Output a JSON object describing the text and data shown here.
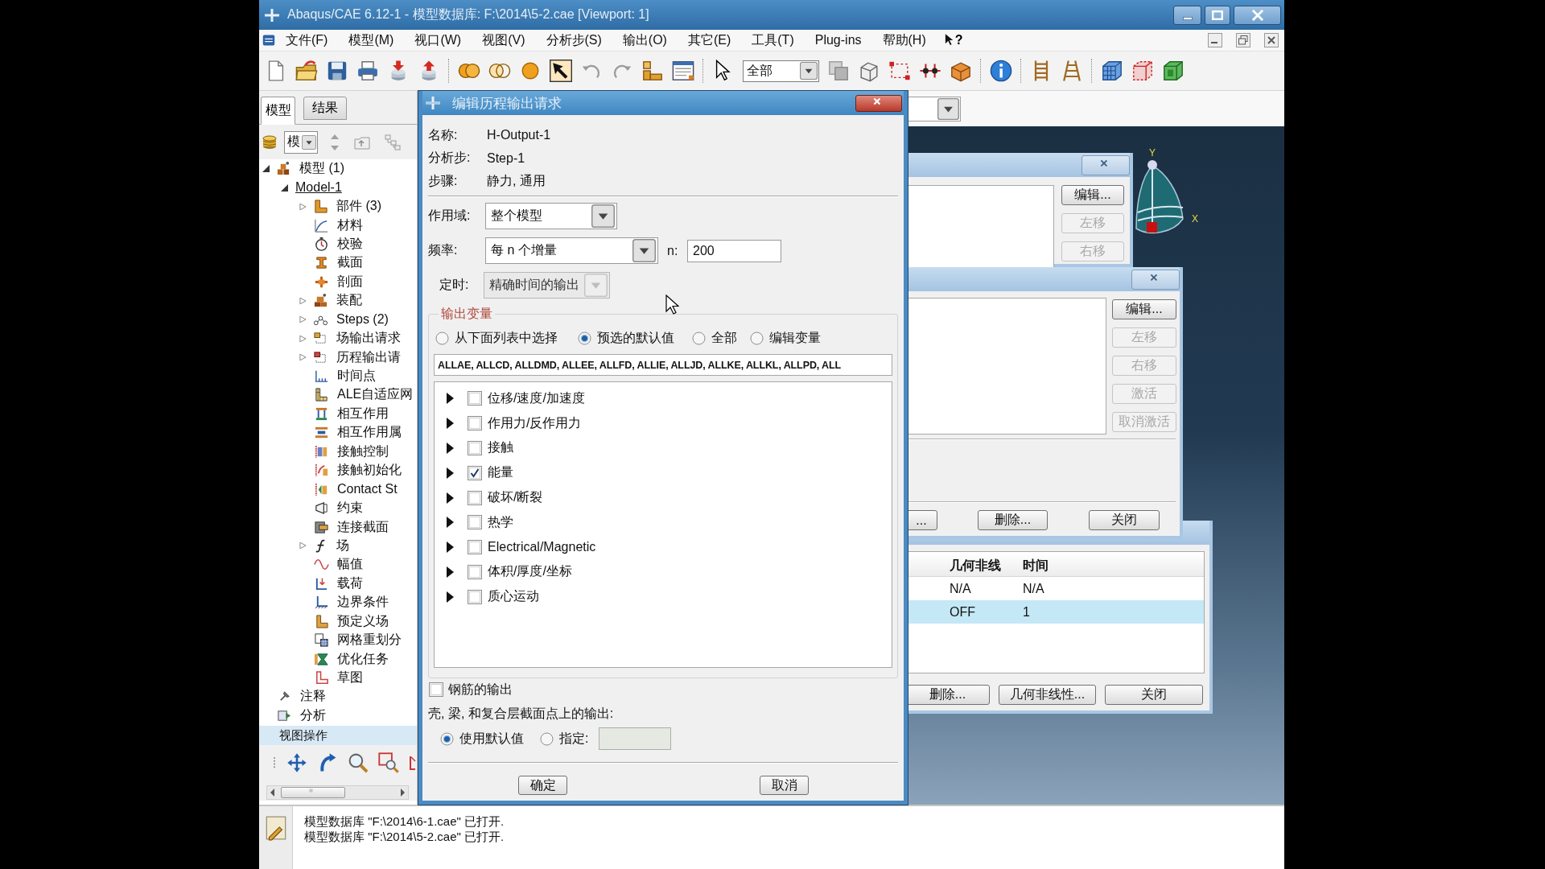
{
  "window": {
    "title": "Abaqus/CAE 6.12-1 - 模型数据库: F:\\2014\\5-2.cae [Viewport: 1]"
  },
  "menu": {
    "items": [
      "文件(F)",
      "模型(M)",
      "视口(W)",
      "视图(V)",
      "分析步(S)",
      "输出(O)",
      "其它(E)",
      "工具(T)",
      "Plug-ins",
      "帮助(H)"
    ],
    "whats_this": "?"
  },
  "toolbar": {
    "selection_filter": "全部"
  },
  "left_panel": {
    "tabs": [
      {
        "label": "模型",
        "selected": true
      },
      {
        "label": "结果",
        "selected": false
      }
    ],
    "tree_filter": "模",
    "tree": [
      {
        "label": "模型 (1)",
        "kind": "models",
        "expanded": true,
        "children": [
          {
            "label": "Model-1",
            "expanded": true,
            "current": true,
            "children": [
              {
                "label": "部件 (3)",
                "kind": "parts",
                "expanded": false
              },
              {
                "label": "材料",
                "kind": "materials"
              },
              {
                "label": "校验",
                "kind": "calibrations"
              },
              {
                "label": "截面",
                "kind": "sections"
              },
              {
                "label": "剖面",
                "kind": "profiles"
              },
              {
                "label": "装配",
                "kind": "assembly",
                "expanded": false
              },
              {
                "label": "Steps (2)",
                "kind": "steps",
                "expanded": false
              },
              {
                "label": "场输出请求",
                "kind": "fieldoutput",
                "expanded": false
              },
              {
                "label": "历程输出请",
                "kind": "historyoutput",
                "expanded": false
              },
              {
                "label": "时间点",
                "kind": "timepoints"
              },
              {
                "label": "ALE自适应网",
                "kind": "ale"
              },
              {
                "label": "相互作用",
                "kind": "interactions"
              },
              {
                "label": "相互作用属",
                "kind": "interactionprops"
              },
              {
                "label": "接触控制",
                "kind": "contactcontrols"
              },
              {
                "label": "接触初始化",
                "kind": "contactinits"
              },
              {
                "label": "Contact St",
                "kind": "contactstabilizations"
              },
              {
                "label": "约束",
                "kind": "constraints"
              },
              {
                "label": "连接截面",
                "kind": "connectorsections"
              },
              {
                "label": "场",
                "kind": "fields",
                "expanded": false
              },
              {
                "label": "幅值",
                "kind": "amplitudes"
              },
              {
                "label": "载荷",
                "kind": "loads"
              },
              {
                "label": "边界条件",
                "kind": "bcs"
              },
              {
                "label": "预定义场",
                "kind": "predefined"
              },
              {
                "label": "网格重划分",
                "kind": "remeshing"
              },
              {
                "label": "优化任务",
                "kind": "optimization"
              },
              {
                "label": "草图",
                "kind": "sketches"
              }
            ]
          }
        ]
      },
      {
        "label": "注释",
        "kind": "annotations"
      },
      {
        "label": "分析",
        "kind": "analysis"
      }
    ],
    "toolbox_title": "视图操作"
  },
  "viewport": {
    "triad": {
      "y_label": "Y",
      "x_label": "X"
    }
  },
  "messages": [
    "模型数据库 \"F:\\2014\\6-1.cae\" 已打开.",
    "模型数据库 \"F:\\2014\\5-2.cae\" 已打开."
  ],
  "background_dialogs": [
    {
      "kind": "list",
      "side_buttons": [
        {
          "label": "编辑...",
          "disabled": false
        },
        {
          "label": "左移",
          "disabled": true
        },
        {
          "label": "右移",
          "disabled": true
        }
      ]
    },
    {
      "kind": "list",
      "side_buttons": [
        {
          "label": "编辑...",
          "disabled": false
        },
        {
          "label": "左移",
          "disabled": true
        },
        {
          "label": "右移",
          "disabled": true
        },
        {
          "label": "激活",
          "disabled": true
        },
        {
          "label": "取消激活",
          "disabled": true
        }
      ],
      "footer_buttons": [
        "...",
        "删除...",
        "关闭"
      ]
    },
    {
      "kind": "table",
      "columns": [
        "几何非线",
        "时间"
      ],
      "rows": [
        {
          "cells": [
            "N/A",
            "N/A"
          ],
          "selected": false
        },
        {
          "cells": [
            "OFF",
            "1"
          ],
          "selected": true
        }
      ],
      "footer_buttons": [
        "删除...",
        "几何非线性...",
        "关闭"
      ]
    }
  ],
  "history_output_dialog": {
    "title": "编辑历程输出请求",
    "info": [
      {
        "label": "名称:",
        "value": "H-Output-1"
      },
      {
        "label": "分析步:",
        "value": "Step-1"
      },
      {
        "label": "步骤:",
        "value": "静力, 通用"
      }
    ],
    "domain": {
      "label": "作用域:",
      "value": "整个模型"
    },
    "frequency": {
      "label": "频率:",
      "value": "每 n 个增量",
      "n_label": "n:",
      "n_value": "200"
    },
    "timing": {
      "label": "定时:",
      "value": "精确时间的输出",
      "disabled": true
    },
    "output_variables": {
      "title": "输出变量",
      "options": [
        {
          "label": "从下面列表中选择",
          "selected": false
        },
        {
          "label": "预选的默认值",
          "selected": true
        },
        {
          "label": "全部",
          "selected": false
        },
        {
          "label": "编辑变量",
          "selected": false
        }
      ],
      "variables": "ALLAE, ALLCD, ALLDMD, ALLEE, ALLFD, ALLIE, ALLJD, ALLKE, ALLKL, ALLPD, ALL",
      "categories": [
        {
          "label": "位移/速度/加速度",
          "checked": false
        },
        {
          "label": "作用力/反作用力",
          "checked": false
        },
        {
          "label": "接触",
          "checked": false
        },
        {
          "label": "能量",
          "checked": true
        },
        {
          "label": "破坏/断裂",
          "checked": false
        },
        {
          "label": "热学",
          "checked": false
        },
        {
          "label": "Electrical/Magnetic",
          "checked": false
        },
        {
          "label": "体积/厚度/坐标",
          "checked": false
        },
        {
          "label": "质心运动",
          "checked": false
        }
      ]
    },
    "rebar": {
      "label": "钢筋的输出",
      "checked": false
    },
    "section_points": {
      "label": "壳, 梁, 和复合层截面点上的输出:",
      "options": [
        {
          "label": "使用默认值",
          "selected": true
        },
        {
          "label": "指定:",
          "selected": false
        }
      ],
      "field_disabled": true
    },
    "buttons": [
      "确定",
      "取消"
    ]
  }
}
